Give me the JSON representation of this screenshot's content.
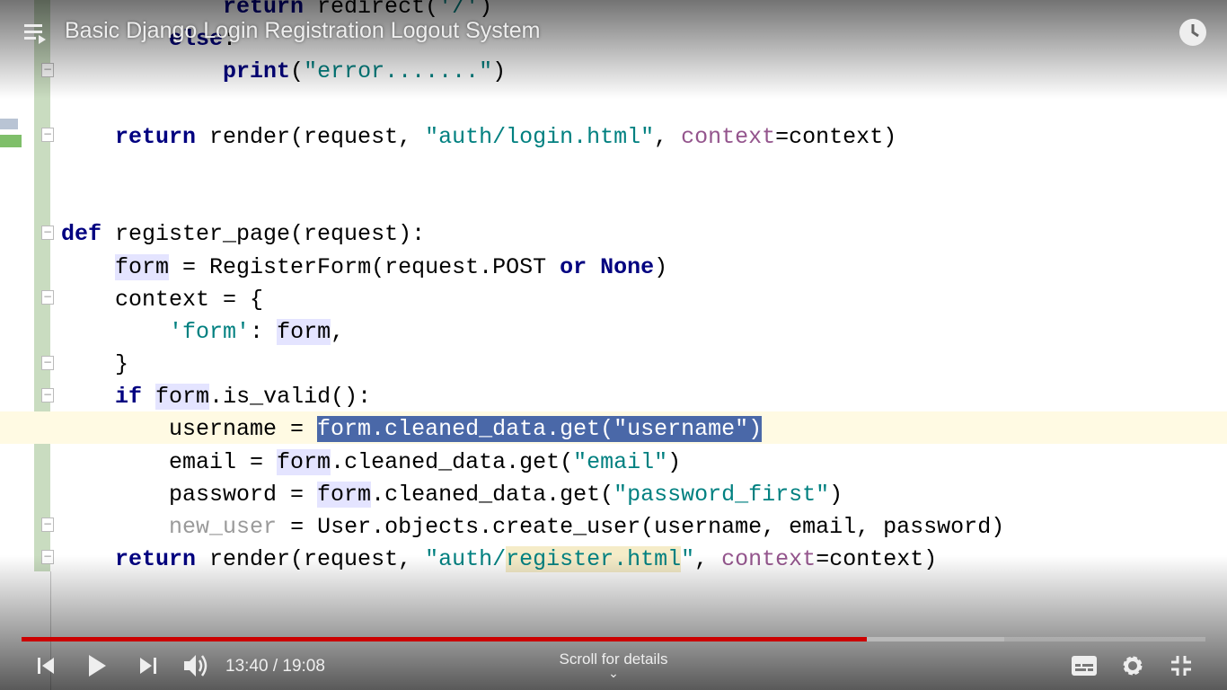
{
  "player": {
    "title": "Basic Django Login Registration Logout System",
    "current_time": "13:40",
    "duration": "19:08",
    "time_display": "13:40 / 19:08",
    "progress_percent": 71.4,
    "scroll_hint": "Scroll for details",
    "accent_color": "#cc0000",
    "icons": [
      "playlist-icon",
      "watch-later-icon",
      "previous-icon",
      "play-icon",
      "next-icon",
      "volume-icon",
      "subtitles-icon",
      "settings-icon",
      "exit-fullscreen-icon",
      "chevron-down-icon"
    ]
  },
  "code_lines": [
    [
      {
        "t": "            "
      },
      {
        "t": "return",
        "c": "kw"
      },
      {
        "t": " redirect("
      },
      {
        "t": "'/'",
        "c": "str"
      },
      {
        "t": ")"
      }
    ],
    [
      {
        "t": "        "
      },
      {
        "t": "else",
        "c": "kw"
      },
      {
        "t": ":"
      }
    ],
    [
      {
        "t": "            "
      },
      {
        "t": "print",
        "c": "kw"
      },
      {
        "t": "("
      },
      {
        "t": "\"error.......\"",
        "c": "str"
      },
      {
        "t": ")"
      }
    ],
    [
      {
        "t": ""
      }
    ],
    [
      {
        "t": "    "
      },
      {
        "t": "return",
        "c": "kw"
      },
      {
        "t": " render(request, "
      },
      {
        "t": "\"auth/login.html\"",
        "c": "str"
      },
      {
        "t": ", "
      },
      {
        "t": "context",
        "c": "prm"
      },
      {
        "t": "=context)"
      }
    ],
    [
      {
        "t": ""
      }
    ],
    [
      {
        "t": ""
      }
    ],
    [
      {
        "t": "def",
        "c": "kw"
      },
      {
        "t": " register_page(request):"
      }
    ],
    [
      {
        "t": "    "
      },
      {
        "t": "form",
        "c": "var"
      },
      {
        "t": " = RegisterForm(request.POST "
      },
      {
        "t": "or",
        "c": "kw"
      },
      {
        "t": " "
      },
      {
        "t": "None",
        "c": "kw"
      },
      {
        "t": ")"
      }
    ],
    [
      {
        "t": "    context = {"
      }
    ],
    [
      {
        "t": "        "
      },
      {
        "t": "'form'",
        "c": "str"
      },
      {
        "t": ": "
      },
      {
        "t": "form",
        "c": "var"
      },
      {
        "t": ","
      }
    ],
    [
      {
        "t": "    }"
      }
    ],
    [
      {
        "t": "    "
      },
      {
        "t": "if",
        "c": "kw"
      },
      {
        "t": " "
      },
      {
        "t": "form",
        "c": "var"
      },
      {
        "t": ".is_valid():"
      }
    ],
    [
      {
        "t": "        username = "
      },
      {
        "t": "form.cleaned_data.get(\"username\")",
        "c": "sel"
      }
    ],
    [
      {
        "t": "        email = "
      },
      {
        "t": "form",
        "c": "var"
      },
      {
        "t": ".cleaned_data.get("
      },
      {
        "t": "\"email\"",
        "c": "str"
      },
      {
        "t": ")"
      }
    ],
    [
      {
        "t": "        password = "
      },
      {
        "t": "form",
        "c": "var"
      },
      {
        "t": ".cleaned_data.get("
      },
      {
        "t": "\"password_first\"",
        "c": "str"
      },
      {
        "t": ")"
      }
    ],
    [
      {
        "t": "        "
      },
      {
        "t": "new_user",
        "c": "dim"
      },
      {
        "t": " = User.objects.create_user(username, email, password)"
      }
    ],
    [
      {
        "t": "    "
      },
      {
        "t": "return",
        "c": "kw"
      },
      {
        "t": " render(request, "
      },
      {
        "t": "\"auth/",
        "c": "str"
      },
      {
        "t": "register.html",
        "c": "str hl"
      },
      {
        "t": "\"",
        "c": "str"
      },
      {
        "t": ", "
      },
      {
        "t": "context",
        "c": "prm"
      },
      {
        "t": "=context)"
      }
    ]
  ]
}
